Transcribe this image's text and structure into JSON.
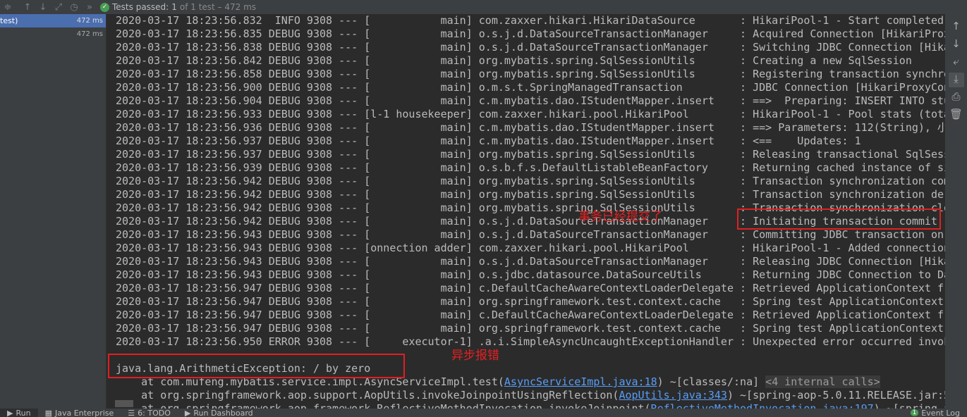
{
  "toolbar": {
    "icons": [
      "sort-icon",
      "up-arrow-icon",
      "down-arrow-icon",
      "export-icon",
      "history-icon"
    ],
    "status_prefix": "Tests passed:",
    "status_count": "1",
    "status_suffix": "of 1 test – 472 ms"
  },
  "tree": [
    {
      "label": "test)",
      "time": "472 ms"
    },
    {
      "label": "",
      "time": "472 ms"
    }
  ],
  "log_lines": [
    "2020-03-17 18:23:56.832  INFO 9308 --- [           main] com.zaxxer.hikari.HikariDataSource       : HikariPool-1 - Start completed.",
    "2020-03-17 18:23:56.835 DEBUG 9308 --- [           main] o.s.j.d.DataSourceTransactionManager     : Acquired Connection [HikariProxy",
    "2020-03-17 18:23:56.838 DEBUG 9308 --- [           main] o.s.j.d.DataSourceTransactionManager     : Switching JDBC Connection [Hika",
    "2020-03-17 18:23:56.842 DEBUG 9308 --- [           main] org.mybatis.spring.SqlSessionUtils       : Creating a new SqlSession",
    "2020-03-17 18:23:56.858 DEBUG 9308 --- [           main] org.mybatis.spring.SqlSessionUtils       : Registering transaction synchro",
    "2020-03-17 18:23:56.900 DEBUG 9308 --- [           main] o.m.s.t.SpringManagedTransaction         : JDBC Connection [HikariProxyCon",
    "2020-03-17 18:23:56.904 DEBUG 9308 --- [           main] c.m.mybatis.dao.IStudentMapper.insert    : ==>  Preparing: INSERT INTO stu",
    "2020-03-17 18:23:56.933 DEBUG 9308 --- [l-1 housekeeper] com.zaxxer.hikari.pool.HikariPool        : HikariPool-1 - Pool stats (tota",
    "2020-03-17 18:23:56.936 DEBUG 9308 --- [           main] c.m.mybatis.dao.IStudentMapper.insert    : ==> Parameters: 112(String), 小",
    "2020-03-17 18:23:56.937 DEBUG 9308 --- [           main] c.m.mybatis.dao.IStudentMapper.insert    : <==    Updates: 1",
    "2020-03-17 18:23:56.937 DEBUG 9308 --- [           main] org.mybatis.spring.SqlSessionUtils       : Releasing transactional SqlSess",
    "2020-03-17 18:23:56.939 DEBUG 9308 --- [           main] o.s.b.f.s.DefaultListableBeanFactory     : Returning cached instance of si",
    "2020-03-17 18:23:56.942 DEBUG 9308 --- [           main] org.mybatis.spring.SqlSessionUtils       : Transaction synchronization com",
    "2020-03-17 18:23:56.942 DEBUG 9308 --- [           main] org.mybatis.spring.SqlSessionUtils       : Transaction synchronization der",
    "2020-03-17 18:23:56.942 DEBUG 9308 --- [           main] org.mybatis.spring.SqlSessionUtils       : Transaction synchronization clo",
    "2020-03-17 18:23:56.942 DEBUG 9308 --- [           main] o.s.j.d.DataSourceTransactionManager     : Initiating transaction commit",
    "2020-03-17 18:23:56.943 DEBUG 9308 --- [           main] o.s.j.d.DataSourceTransactionManager     : Committing JDBC transaction on",
    "2020-03-17 18:23:56.943 DEBUG 9308 --- [onnection adder] com.zaxxer.hikari.pool.HikariPool        : HikariPool-1 - Added connection",
    "2020-03-17 18:23:56.943 DEBUG 9308 --- [           main] o.s.j.d.DataSourceTransactionManager     : Releasing JDBC Connection [Hika",
    "2020-03-17 18:23:56.943 DEBUG 9308 --- [           main] o.s.jdbc.datasource.DataSourceUtils      : Returning JDBC Connection to Da",
    "2020-03-17 18:23:56.947 DEBUG 9308 --- [           main] c.DefaultCacheAwareContextLoaderDelegate : Retrieved ApplicationContext fr",
    "2020-03-17 18:23:56.947 DEBUG 9308 --- [           main] org.springframework.test.context.cache   : Spring test ApplicationContext",
    "2020-03-17 18:23:56.947 DEBUG 9308 --- [           main] c.DefaultCacheAwareContextLoaderDelegate : Retrieved ApplicationContext fr",
    "2020-03-17 18:23:56.947 DEBUG 9308 --- [           main] org.springframework.test.context.cache   : Spring test ApplicationContext",
    "2020-03-17 18:23:56.950 ERROR 9308 --- [     executor-1] .a.i.SimpleAsyncUncaughtExceptionHandler : Unexpected error occurred invok"
  ],
  "exception": {
    "message": "java.lang.ArithmeticException: / by zero",
    "frames": [
      {
        "prefix": "    at com.mufeng.mybatis.service.impl.AsyncServiceImpl.test(",
        "link": "AsyncServiceImpl.java:18",
        "suffix": ") ~[classes/:na] ",
        "extra": "<4 internal calls>"
      },
      {
        "prefix": "    at org.springframework.aop.support.AopUtils.invokeJoinpointUsingReflection(",
        "link": "AopUtils.java:343",
        "suffix": ") ~[spring-aop-5.0.11.RELEASE.jar:5",
        "extra": ""
      },
      {
        "prefix": "    at org.springframework.aop.framework.ReflectiveMethodInvocation.invokeJoinpoint(",
        "link": "ReflectiveMethodInvocation.java:197",
        "suffix": ") ~[spring-a",
        "extra": ""
      }
    ]
  },
  "annotations": {
    "committed": "事务已经提交了",
    "async_error": "异步报错",
    "color": "#e02020"
  },
  "gutter_icons": [
    "up-arrow-icon",
    "down-arrow-icon",
    "soft-wrap-icon",
    "scroll-to-end-icon",
    "print-icon",
    "trash-icon"
  ],
  "bottom_tabs": [
    {
      "label": "Run"
    },
    {
      "label": "Java Enterprise"
    },
    {
      "label": "6: TODO"
    },
    {
      "label": "Run Dashboard"
    }
  ],
  "event_log": {
    "count": "1",
    "label": "Event Log"
  }
}
